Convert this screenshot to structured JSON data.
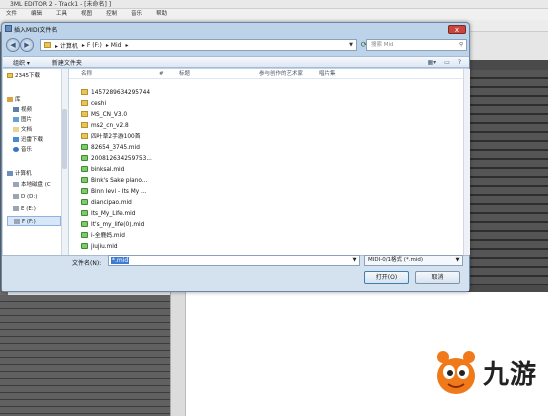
{
  "app": {
    "title": "3ML EDITOR 2 - Track1 - [未命名] ]",
    "menu": [
      "文件",
      "编辑",
      "工具",
      "视图",
      "控制",
      "音乐",
      "帮助"
    ]
  },
  "dialog": {
    "title": "插入MIDI文件名",
    "close_label": "x",
    "breadcrumb": [
      "▸ 计算机",
      "▸ F (F:)",
      "▸ Mid",
      "▸"
    ],
    "search_placeholder": "搜索 Mid",
    "toolbar": {
      "organize": "组织 ▾",
      "new_folder": "新建文件夹"
    },
    "nav": [
      {
        "label": "2345下载",
        "icon": "folder-icon"
      },
      {
        "label": "库",
        "icon": "library-icon"
      },
      {
        "label": "视频",
        "icon": "video-icon"
      },
      {
        "label": "图片",
        "icon": "picture-icon"
      },
      {
        "label": "文档",
        "icon": "document-icon"
      },
      {
        "label": "迅雷下载",
        "icon": "download-icon"
      },
      {
        "label": "音乐",
        "icon": "music-icon"
      },
      {
        "label": "计算机",
        "icon": "computer-icon"
      },
      {
        "label": "本地磁盘 (C",
        "icon": "drive-icon"
      },
      {
        "label": "D (D:)",
        "icon": "drive-icon"
      },
      {
        "label": "E (E:)",
        "icon": "drive-icon"
      },
      {
        "label": "F (F:)",
        "icon": "drive-icon"
      }
    ],
    "columns": {
      "name": "名称",
      "num": "#",
      "title": "标题",
      "artist": "参与创作的艺术家",
      "album": "唱片集"
    },
    "files": [
      {
        "name": "1457289634295744",
        "type": "folder"
      },
      {
        "name": "ceshi",
        "type": "folder"
      },
      {
        "name": "MS_CN_V3.0",
        "type": "folder"
      },
      {
        "name": "ms2_cn_v2.8",
        "type": "folder"
      },
      {
        "name": "四叶草2手游100首",
        "type": "folder"
      },
      {
        "name": "82654_3745.mid",
        "type": "midi"
      },
      {
        "name": "200812634259753...",
        "type": "midi"
      },
      {
        "name": "binksal.mid",
        "type": "midi"
      },
      {
        "name": "Bink's Sake piano...",
        "type": "midi"
      },
      {
        "name": "Binn Ievi - Its My ...",
        "type": "midi"
      },
      {
        "name": "diancipao.mid",
        "type": "midi"
      },
      {
        "name": "Its_My_Life.mid",
        "type": "midi"
      },
      {
        "name": "It's_my_life(0).mid",
        "type": "midi"
      },
      {
        "name": "i-全鹿妈.mid",
        "type": "midi"
      },
      {
        "name": "jiujiu.mid",
        "type": "midi"
      }
    ],
    "filename_label": "文件名(N):",
    "filename_value": "*.mid",
    "filetype_value": "MIDI-0/1格式 (*.mid)",
    "open_label": "打开(O)",
    "cancel_label": "取消"
  },
  "watermark": {
    "text": "九游"
  }
}
